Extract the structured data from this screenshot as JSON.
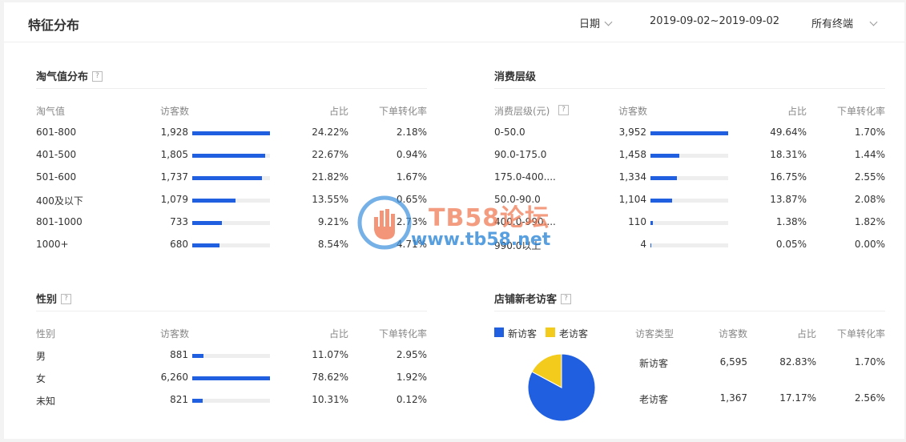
{
  "header": {
    "title": "特征分布",
    "date_label": "日期",
    "date_range": "2019-09-02~2019-09-02",
    "terminal": "所有终端"
  },
  "taoqi": {
    "title": "淘气值分布",
    "help": "?",
    "columns": [
      "淘气值",
      "访客数",
      "占比",
      "下单转化率"
    ],
    "rows": [
      {
        "label": "601-800",
        "visitors": "1,928",
        "share": "24.22%",
        "conv": "2.18%",
        "bar": 1.0
      },
      {
        "label": "401-500",
        "visitors": "1,805",
        "share": "22.67%",
        "conv": "0.94%",
        "bar": 0.936
      },
      {
        "label": "501-600",
        "visitors": "1,737",
        "share": "21.82%",
        "conv": "1.67%",
        "bar": 0.901
      },
      {
        "label": "400及以下",
        "visitors": "1,079",
        "share": "13.55%",
        "conv": "0.65%",
        "bar": 0.56
      },
      {
        "label": "801-1000",
        "visitors": "733",
        "share": "9.21%",
        "conv": "2.73%",
        "bar": 0.38
      },
      {
        "label": "1000+",
        "visitors": "680",
        "share": "8.54%",
        "conv": "4.71%",
        "bar": 0.353
      }
    ]
  },
  "consume": {
    "title": "消费层级",
    "columns": [
      "消费层级(元)",
      "访客数",
      "占比",
      "下单转化率"
    ],
    "help": "?",
    "rows": [
      {
        "label": "0-50.0",
        "visitors": "3,952",
        "share": "49.64%",
        "conv": "1.70%",
        "bar": 1.0
      },
      {
        "label": "90.0-175.0",
        "visitors": "1,458",
        "share": "18.31%",
        "conv": "1.44%",
        "bar": 0.369
      },
      {
        "label": "175.0-400....",
        "visitors": "1,334",
        "share": "16.75%",
        "conv": "2.55%",
        "bar": 0.338
      },
      {
        "label": "50.0-90.0",
        "visitors": "1,104",
        "share": "13.87%",
        "conv": "2.08%",
        "bar": 0.279
      },
      {
        "label": "400.0-990....",
        "visitors": "110",
        "share": "1.38%",
        "conv": "1.82%",
        "bar": 0.028
      },
      {
        "label": "990.0以上",
        "visitors": "4",
        "share": "0.05%",
        "conv": "0.00%",
        "bar": 0.001
      }
    ]
  },
  "gender": {
    "title": "性别",
    "help": "?",
    "columns": [
      "性别",
      "访客数",
      "占比",
      "下单转化率"
    ],
    "rows": [
      {
        "label": "男",
        "visitors": "881",
        "share": "11.07%",
        "conv": "2.95%",
        "bar": 0.141
      },
      {
        "label": "女",
        "visitors": "6,260",
        "share": "78.62%",
        "conv": "1.92%",
        "bar": 1.0
      },
      {
        "label": "未知",
        "visitors": "821",
        "share": "10.31%",
        "conv": "0.12%",
        "bar": 0.131
      }
    ]
  },
  "newold": {
    "title": "店铺新老访客",
    "help": "?",
    "legend": [
      {
        "name": "新访客",
        "color": "#1f5fe0"
      },
      {
        "name": "老访客",
        "color": "#f2cb1d"
      }
    ],
    "columns": [
      "访客类型",
      "访客数",
      "占比",
      "下单转化率"
    ],
    "rows": [
      {
        "label": "新访客",
        "visitors": "6,595",
        "share": "82.83%",
        "conv": "1.70%"
      },
      {
        "label": "老访客",
        "visitors": "1,367",
        "share": "17.17%",
        "conv": "2.56%"
      }
    ]
  },
  "chart_data": {
    "type": "pie",
    "categories": [
      "新访客",
      "老访客"
    ],
    "values": [
      82.83,
      17.17
    ],
    "colors": [
      "#1f5fe0",
      "#f2cb1d"
    ]
  },
  "watermark": {
    "line1": "TB58论坛",
    "line2": "www.tb58.net"
  },
  "colors": {
    "bar": "#1f5fe0",
    "track": "#eeeeee"
  }
}
